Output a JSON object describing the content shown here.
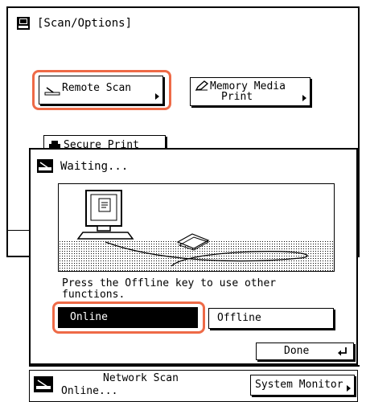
{
  "options_window": {
    "title": "[Scan/Options]",
    "remote_scan_label": "Remote Scan",
    "memory_media_label_line1": "Memory Media",
    "memory_media_label_line2": "Print",
    "secure_print_label": "Secure Print"
  },
  "dialog": {
    "title": "Waiting...",
    "message_line1": "Press the Offline key to use other",
    "message_line2": "functions.",
    "online_label": "Online",
    "offline_label": "Offline",
    "done_label": "Done"
  },
  "status_bar": {
    "mode_label": "Network Scan",
    "status_label": "Online...",
    "system_monitor_label": "System Monitor"
  },
  "colors": {
    "highlight": "#ee6a47",
    "selected_button_bg": "#000000",
    "selected_button_text": "#ffffff"
  },
  "icons": [
    "scanner-icon",
    "pencil-icon",
    "printer-icon",
    "enter-arrow-icon",
    "computer-icon",
    "document-icon"
  ]
}
